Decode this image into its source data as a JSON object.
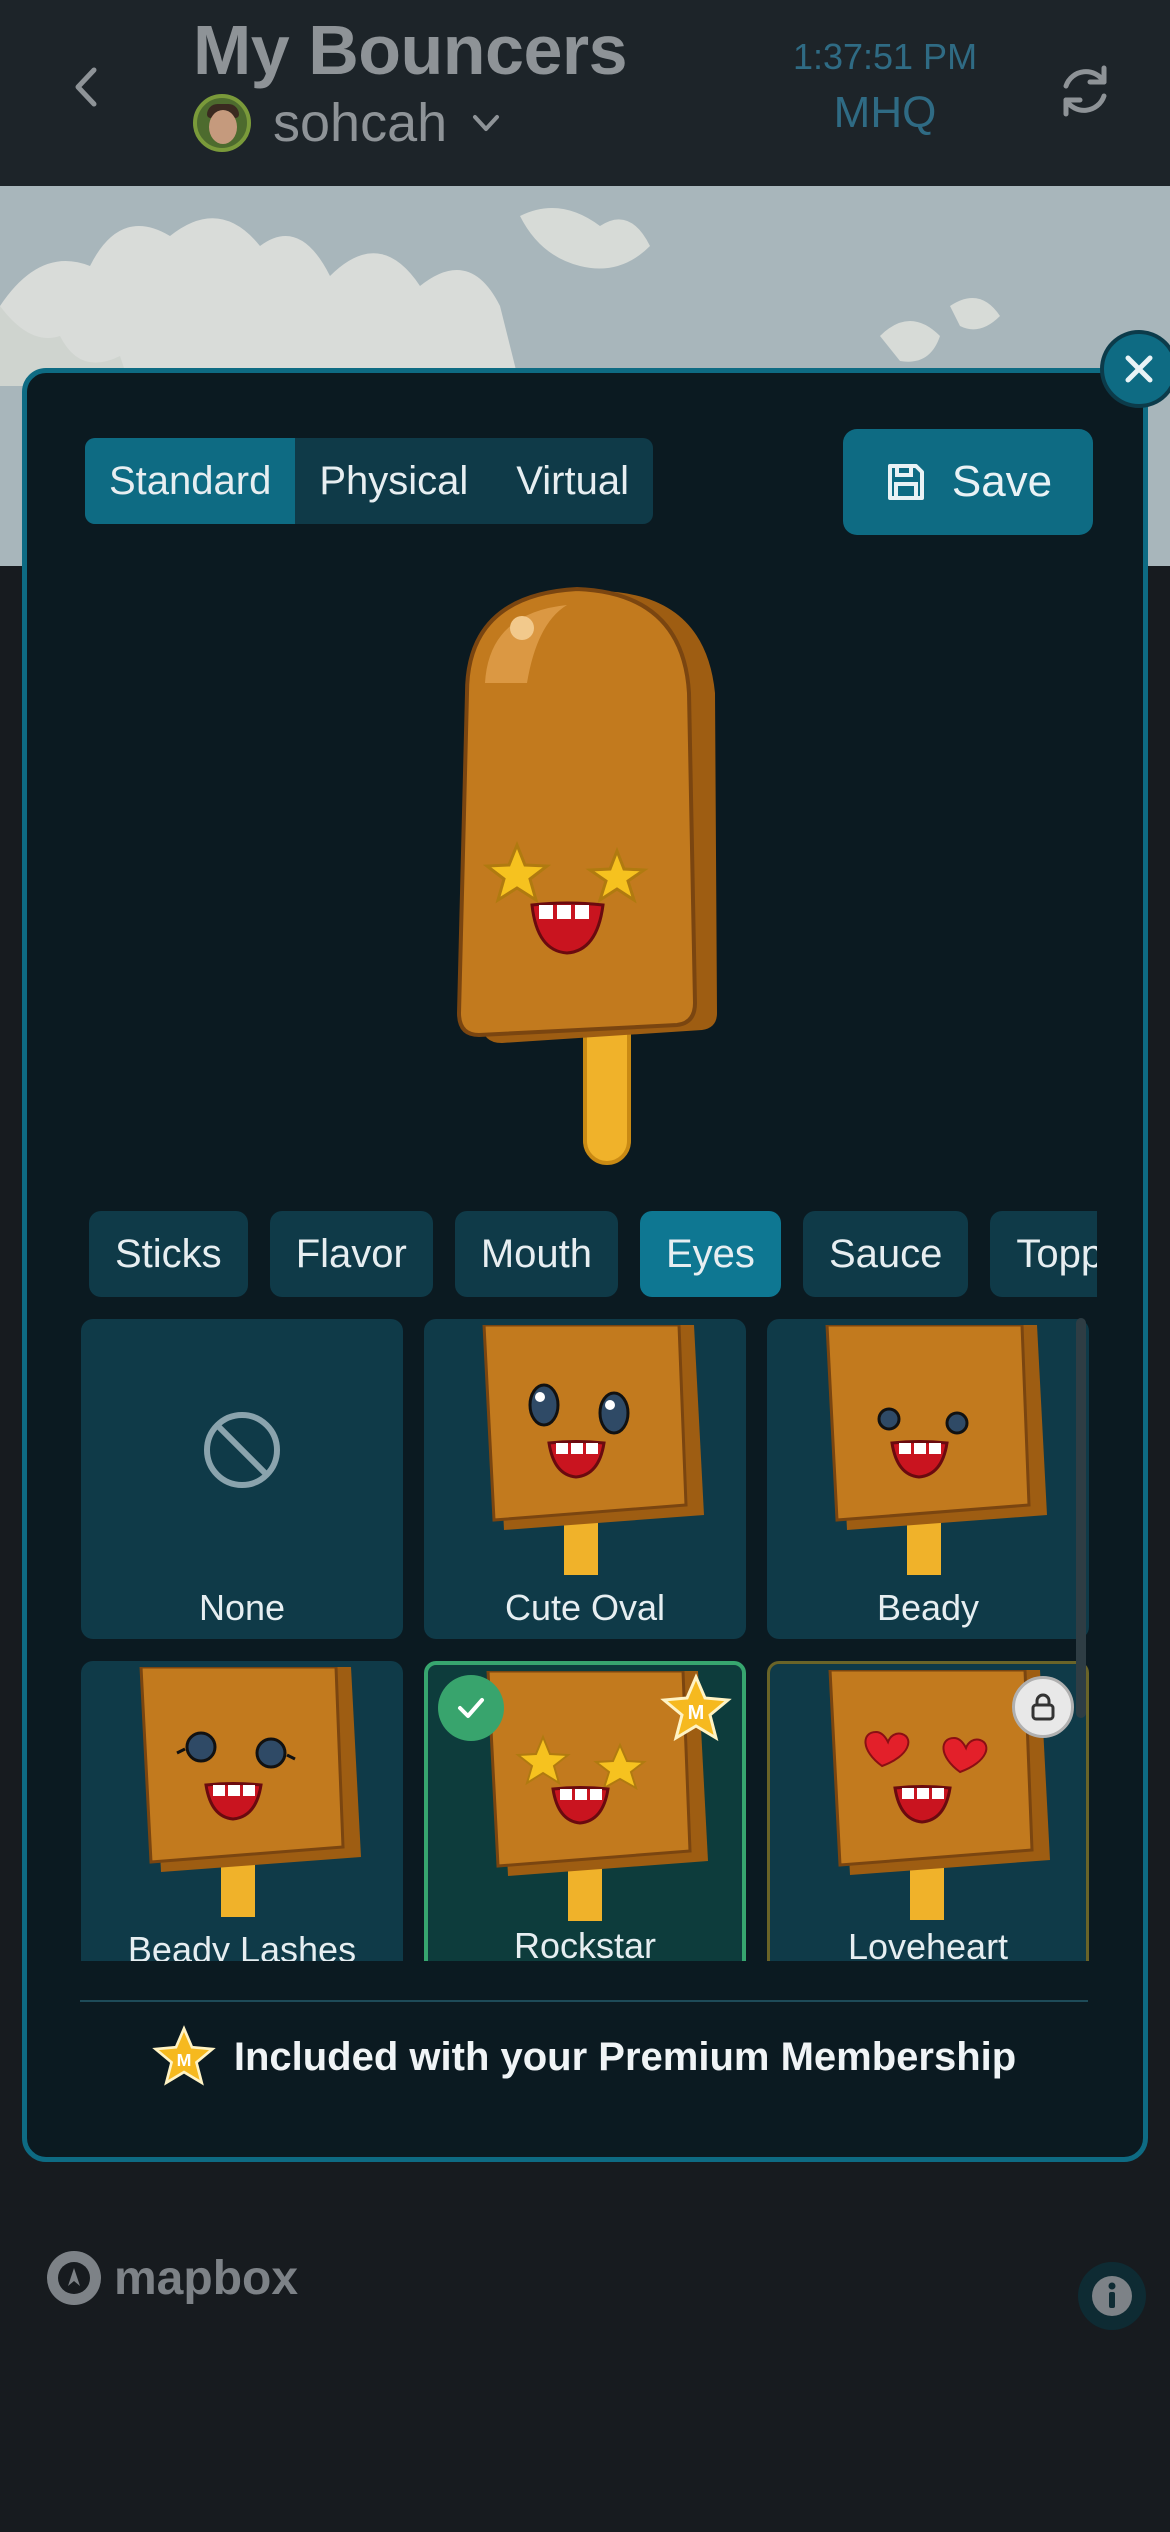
{
  "header": {
    "title": "My Bouncers",
    "username": "sohcah",
    "time": "1:37:51 PM",
    "hq": "MHQ"
  },
  "tabs": [
    {
      "label": "Standard",
      "active": true
    },
    {
      "label": "Physical",
      "active": false
    },
    {
      "label": "Virtual",
      "active": false
    }
  ],
  "save_label": "Save",
  "categories": [
    {
      "label": "Sticks"
    },
    {
      "label": "Flavor"
    },
    {
      "label": "Mouth"
    },
    {
      "label": "Eyes",
      "active": true
    },
    {
      "label": "Sauce"
    },
    {
      "label": "Toppings"
    }
  ],
  "options": [
    {
      "label": "None",
      "state": "available"
    },
    {
      "label": "Cute Oval",
      "state": "available"
    },
    {
      "label": "Beady",
      "state": "available"
    },
    {
      "label": "Beady Lashes",
      "state": "available"
    },
    {
      "label": "Rockstar",
      "state": "selected",
      "premium": true
    },
    {
      "label": "Loveheart",
      "state": "locked"
    }
  ],
  "premium_note": "Included with your Premium Membership",
  "attribution": "mapbox",
  "colors": {
    "accent": "#0e6b83",
    "selected_border": "#37a66f",
    "modal_bg": "#0b1a21",
    "popsicle": "#c27a1e"
  }
}
